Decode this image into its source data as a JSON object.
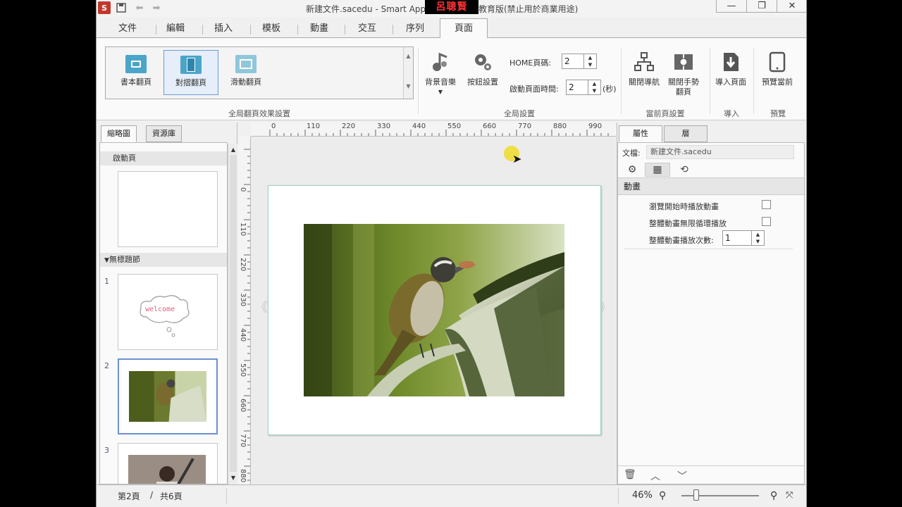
{
  "titlebar": {
    "title_left": "新建文件.sacedu - Smart Apps",
    "badge": "呂聰賢",
    "title_right": "教育版(禁止用於商業用途)",
    "min_icon": "minimize-icon",
    "max_icon": "maximize-icon",
    "close_icon": "close-icon"
  },
  "menu": {
    "tabs": [
      "文件",
      "編輯",
      "插入",
      "模板",
      "動畫",
      "交互",
      "序列",
      "頁面"
    ],
    "active": "頁面"
  },
  "ribbon": {
    "gallery": [
      "書本翻頁",
      "對摺翻頁",
      "滑動翻頁"
    ],
    "gallery_selected": "對摺翻頁",
    "group1_label": "全局翻頁效果設置",
    "bg_music": "背景音樂",
    "button_settings": "按鈕設置",
    "home_page_label": "HOME頁碼:",
    "home_page_value": "2",
    "start_time_label": "啟動頁面時間:",
    "start_time_value": "2",
    "start_time_unit": "(秒)",
    "group2_label": "全局設置",
    "close_nav": "關閉導航",
    "close_gesture": "關閉手勢翻頁",
    "group3_label": "當前頁設置",
    "import_page": "導入頁面",
    "group4_label": "導入",
    "preview_current": "預覽當前",
    "group5_label": "預覽"
  },
  "left_panel": {
    "tabs": [
      "縮略圖",
      "資源庫"
    ],
    "active_tab": "縮略圖",
    "startup_header": "啟動頁",
    "section_header": "無標題節",
    "pages": [
      "1",
      "2",
      "3"
    ],
    "thumb1_text": "welcome",
    "selected_page": "2"
  },
  "ruler": {
    "h_ticks": [
      "0",
      "110",
      "220",
      "330",
      "440",
      "550",
      "660",
      "770",
      "880",
      "990"
    ],
    "v_ticks": [
      "0",
      "110",
      "220",
      "330",
      "440",
      "550",
      "660",
      "770",
      "880"
    ]
  },
  "right_panel": {
    "tabs": [
      "屬性",
      "層"
    ],
    "active_tab": "屬性",
    "doc_label": "文檔:",
    "doc_value": "新建文件.sacedu",
    "section": "動畫",
    "options": [
      {
        "label": "瀏覽開始時播放動畫",
        "checked": false
      },
      {
        "label": "整體動畫無限循環播放",
        "checked": false
      }
    ],
    "count_label": "整體動畫播放次數:",
    "count_value": "1"
  },
  "status": {
    "page_current": "第2頁",
    "separator": "/",
    "page_total": "共6頁",
    "zoom": "46%"
  },
  "colors": {
    "badge_bg": "#000000",
    "badge_text": "#ff3030",
    "selection": "#6e8fd0",
    "page_border": "#9ccfc0"
  }
}
